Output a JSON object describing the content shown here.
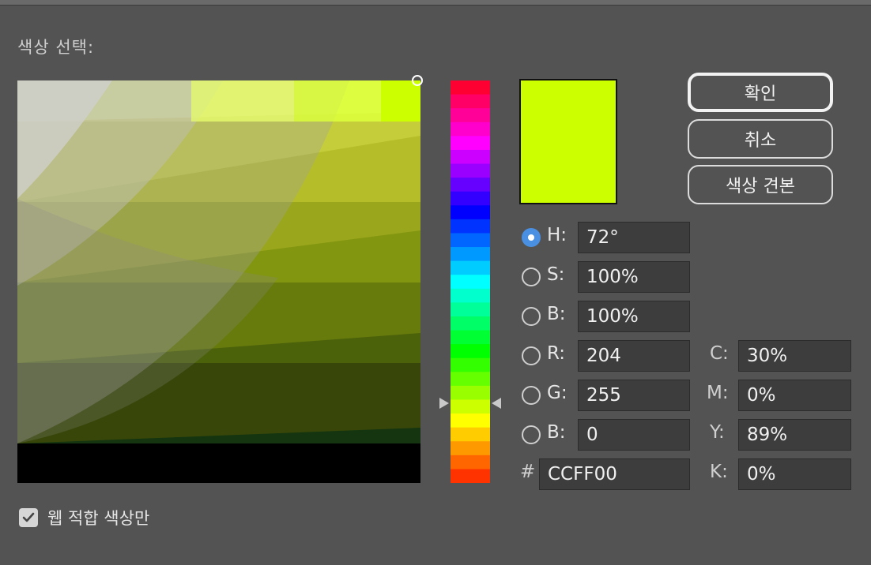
{
  "dialog": {
    "title": "색상 선택:",
    "web_only_label": "웹 적합 색상만",
    "web_only_checked": true
  },
  "current_color": "#CCFF00",
  "buttons": {
    "ok": "확인",
    "cancel": "취소",
    "swatches": "색상 견본"
  },
  "hsb": {
    "h_label": "H:",
    "h_value": "72°",
    "s_label": "S:",
    "s_value": "100%",
    "b_label": "B:",
    "b_value": "100%",
    "selected": "H"
  },
  "rgb": {
    "r_label": "R:",
    "r_value": "204",
    "g_label": "G:",
    "g_value": "255",
    "b_label": "B:",
    "b_value": "0"
  },
  "hex": {
    "label": "#",
    "value": "CCFF00"
  },
  "cmyk": {
    "c_label": "C:",
    "c_value": "30%",
    "m_label": "M:",
    "m_value": "0%",
    "y_label": "Y:",
    "y_value": "89%",
    "k_label": "K:",
    "k_value": "0%"
  },
  "hue_strip_colors": [
    "#ff0033",
    "#ff0066",
    "#ff0099",
    "#ff00cc",
    "#ff00ff",
    "#cc00ff",
    "#9900ff",
    "#6600ff",
    "#3300ff",
    "#0000ff",
    "#0033ff",
    "#0066ff",
    "#0099ff",
    "#00ccff",
    "#00ffff",
    "#00ffcc",
    "#00ff99",
    "#00ff66",
    "#00ff33",
    "#00ff00",
    "#33ff00",
    "#66ff00",
    "#99ff00",
    "#ccff00",
    "#ffff00",
    "#ffcc00",
    "#ff9900",
    "#ff6600",
    "#ff3300"
  ]
}
